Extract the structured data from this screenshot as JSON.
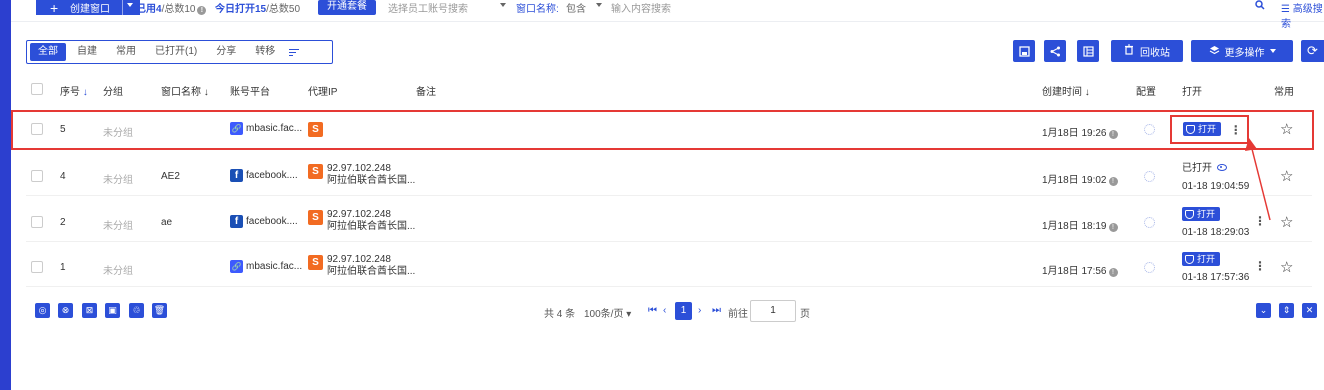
{
  "toolbar": {
    "create_label": "创建窗口",
    "used_label": "已用4",
    "total_label": "/总数10",
    "today_label": "今日打开15",
    "today_total_label": "/总数50",
    "open_package_label": "开通套餐",
    "staff_placeholder": "选择员工账号搜索",
    "window_name_label": "窗口名称:",
    "condition_label": "包含",
    "content_placeholder": "输入内容搜索",
    "advanced_search_label": "高级搜索"
  },
  "tabs": [
    {
      "label": "全部",
      "active": true
    },
    {
      "label": "自建",
      "active": false
    },
    {
      "label": "常用",
      "active": false
    },
    {
      "label": "已打开(1)",
      "active": false
    },
    {
      "label": "分享",
      "active": false
    },
    {
      "label": "转移",
      "active": false
    }
  ],
  "actions": {
    "recycle_label": "回收站",
    "more_ops_label": "更多操作"
  },
  "table": {
    "headers": {
      "seq": "序号",
      "group": "分组",
      "window_name": "窗口名称",
      "platform": "账号平台",
      "proxy": "代理IP",
      "remark": "备注",
      "created": "创建时间",
      "config": "配置",
      "open": "打开",
      "favorite": "常用"
    },
    "rows": [
      {
        "seq": "5",
        "group": "未分组",
        "name": "",
        "platform_icon": "link-icon",
        "platform": "mbasic.fac...",
        "proxy_ip": "",
        "proxy_region": "",
        "created": "1月18日 19:26",
        "status": "open-button",
        "open_label": "打开",
        "open_time": ""
      },
      {
        "seq": "4",
        "group": "未分组",
        "name": "AE2",
        "platform_icon": "facebook-icon",
        "platform": "facebook....",
        "proxy_ip": "92.97.102.248",
        "proxy_region": "阿拉伯联合酋长国...",
        "created": "1月18日 19:02",
        "status": "opened",
        "open_label": "已打开",
        "open_time": "01-18 19:04:59"
      },
      {
        "seq": "2",
        "group": "未分组",
        "name": "ae",
        "platform_icon": "facebook-icon",
        "platform": "facebook....",
        "proxy_ip": "92.97.102.248",
        "proxy_region": "阿拉伯联合酋长国...",
        "created": "1月18日 18:19",
        "status": "open-button",
        "open_label": "打开",
        "open_time": "01-18 18:29:03"
      },
      {
        "seq": "1",
        "group": "未分组",
        "name": "",
        "platform_icon": "link-icon",
        "platform": "mbasic.fac...",
        "proxy_ip": "92.97.102.248",
        "proxy_region": "阿拉伯联合酋长国...",
        "created": "1月18日 17:56",
        "status": "open-button",
        "open_label": "打开",
        "open_time": "01-18 17:57:36"
      }
    ]
  },
  "pagination": {
    "total_label": "共 4 条",
    "page_size_label": "100条/页",
    "current_page": "1",
    "goto_label": "前往",
    "goto_value": "1",
    "page_unit": "页"
  },
  "colors": {
    "accent": "#2c4fd8",
    "highlight": "#e53935",
    "proxy": "#f26b22"
  }
}
